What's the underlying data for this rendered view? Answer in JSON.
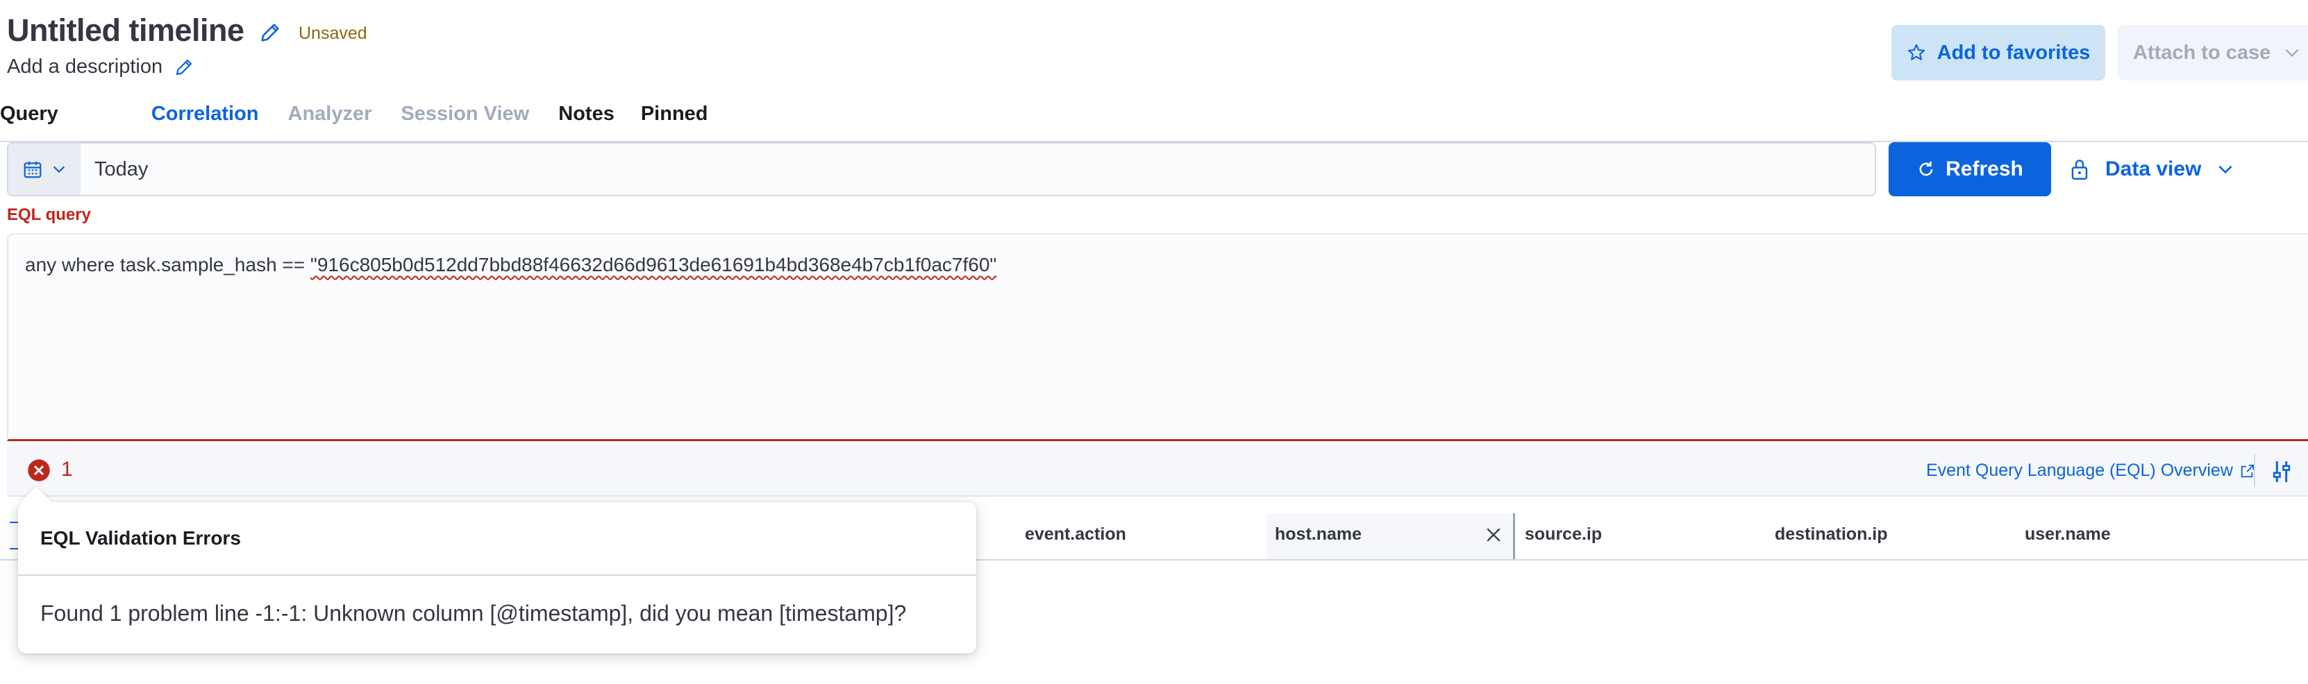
{
  "header": {
    "title": "Untitled timeline",
    "status_badge": "Unsaved",
    "description": "Add a description",
    "favorites_label": "Add to favorites",
    "attach_label": "Attach to case"
  },
  "tabs": [
    {
      "label": "Query",
      "state": "normal"
    },
    {
      "label": "Correlation",
      "state": "selected"
    },
    {
      "label": "Analyzer",
      "state": "disabled"
    },
    {
      "label": "Session View",
      "state": "disabled"
    },
    {
      "label": "Notes",
      "state": "normal"
    },
    {
      "label": "Pinned",
      "state": "normal"
    }
  ],
  "date_range": {
    "value": "Today",
    "refresh_label": "Refresh",
    "data_view_label": "Data view"
  },
  "eql": {
    "label": "EQL query",
    "query_prefix": "any where task.sample_hash == ",
    "query_hash": "\"916c805b0d512dd7bbd88f46632d66d9613de61691b4bd368e4b7cb1f0ac7f60\"",
    "error_count": "1",
    "overview_link": "Event Query Language (EQL) Overview"
  },
  "table": {
    "columns": [
      "event.action",
      "host.name",
      "source.ip",
      "destination.ip",
      "user.name"
    ]
  },
  "popover": {
    "title": "EQL Validation Errors",
    "message": "Found 1 problem line -1:-1: Unknown column [@timestamp], did you mean [timestamp]?"
  },
  "icons": {
    "title_edit": "pencil-icon",
    "favorites": "star-icon",
    "attach": "chevron-down-icon",
    "calendar": "calendar-icon",
    "refresh": "refresh-icon",
    "lock": "lock-icon",
    "error": "error-x-icon",
    "external": "external-link-icon",
    "settings": "settings-sliders-icon",
    "close": "close-icon"
  },
  "colors": {
    "primary": "#0b64dd",
    "danger": "#bd271e",
    "warning_text": "#8a6a0a",
    "fav_bg": "#cce4f5"
  }
}
